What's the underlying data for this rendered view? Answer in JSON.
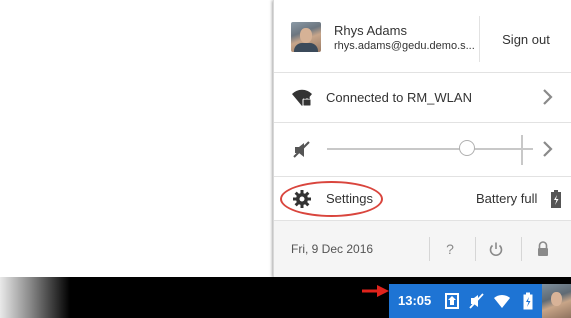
{
  "user": {
    "name": "Rhys Adams",
    "email": "rhys.adams@gedu.demo.s...",
    "sign_out_label": "Sign out"
  },
  "network": {
    "label": "Connected to RM_WLAN",
    "icon": "wifi-locked-icon"
  },
  "volume": {
    "icon": "volume-muted-icon",
    "level": 0.68
  },
  "settings": {
    "label": "Settings",
    "icon": "gear-icon",
    "battery_label": "Battery full",
    "battery_icon": "battery-charging-icon"
  },
  "footer": {
    "date": "Fri, 9 Dec 2016",
    "help_label": "?",
    "icons": [
      "help-icon",
      "power-icon",
      "lock-icon"
    ]
  },
  "shelf": {
    "clock": "13:05",
    "tray_icons": [
      "managed-device-icon",
      "volume-muted-icon",
      "wifi-icon",
      "battery-charging-icon",
      "avatar"
    ],
    "status_area_color": "#1e74d4"
  },
  "annotations": {
    "highlight_color": "#d9453d",
    "arrow_color": "#e0231c"
  }
}
